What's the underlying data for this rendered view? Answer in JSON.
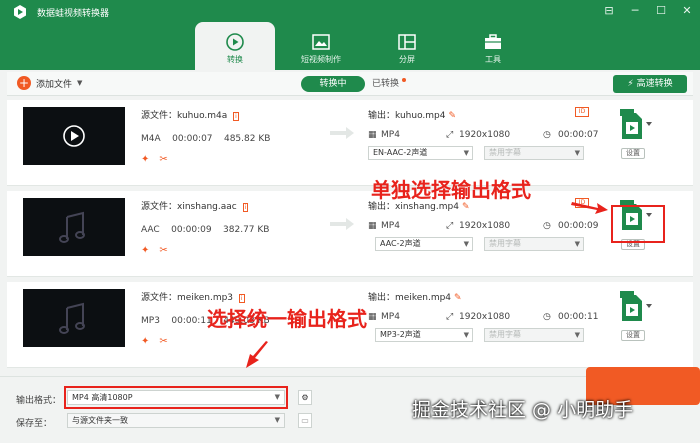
{
  "app": {
    "title": "数据蛙视频转换器",
    "window_buttons": [
      "⊟",
      "─",
      "☐",
      "✕"
    ]
  },
  "tabs": [
    {
      "label": "转换",
      "icon": "convert-icon",
      "active": true
    },
    {
      "label": "短视频制作",
      "icon": "film-icon",
      "active": false
    },
    {
      "label": "分屏",
      "icon": "split-screen-icon",
      "active": false
    },
    {
      "label": "工具",
      "icon": "toolbox-icon",
      "active": false
    }
  ],
  "toolbar": {
    "add_file": "添加文件",
    "converting": "转换中",
    "converted": "已转换",
    "fast_convert": "高速转换"
  },
  "files": [
    {
      "source_label": "源文件：",
      "source": "kuhuo.m4a",
      "format": "M4A",
      "duration": "00:00:07",
      "size": "485.82 KB",
      "output_label": "输出：",
      "output": "kuhuo.mp4",
      "out_format": "MP4",
      "resolution": "1920x1080",
      "out_duration": "00:00:07",
      "audio": "EN-AAC-2声道",
      "subtitle": "禁用字幕",
      "settings": "设置"
    },
    {
      "source_label": "源文件：",
      "source": "xinshang.aac",
      "format": "AAC",
      "duration": "00:00:09",
      "size": "382.77 KB",
      "output_label": "输出：",
      "output": "xinshang.mp4",
      "out_format": "MP4",
      "resolution": "1920x1080",
      "out_duration": "00:00:09",
      "audio": "AAC-2声道",
      "subtitle": "禁用字幕",
      "settings": "设置"
    },
    {
      "source_label": "源文件：",
      "source": "meiken.mp3",
      "format": "MP3",
      "duration": "00:00:11",
      "size": "449.03 KB",
      "output_label": "输出：",
      "output": "meiken.mp4",
      "out_format": "MP4",
      "resolution": "1920x1080",
      "out_duration": "00:00:11",
      "audio": "MP3-2声道",
      "subtitle": "禁用字幕",
      "settings": "设置"
    }
  ],
  "annotations": {
    "single": "单独选择输出格式",
    "all": "选择统一输出格式"
  },
  "bottom": {
    "output_format_label": "输出格式：",
    "output_format_value": "MP4 高清1080P",
    "save_to_label": "保存至：",
    "save_to_value": "与源文件夹一致"
  },
  "watermark": "掘金技术社区 @ 小明助手",
  "colors": {
    "brand": "#1f8a4c",
    "accent": "#f15a24",
    "annotation": "#e8231c"
  }
}
